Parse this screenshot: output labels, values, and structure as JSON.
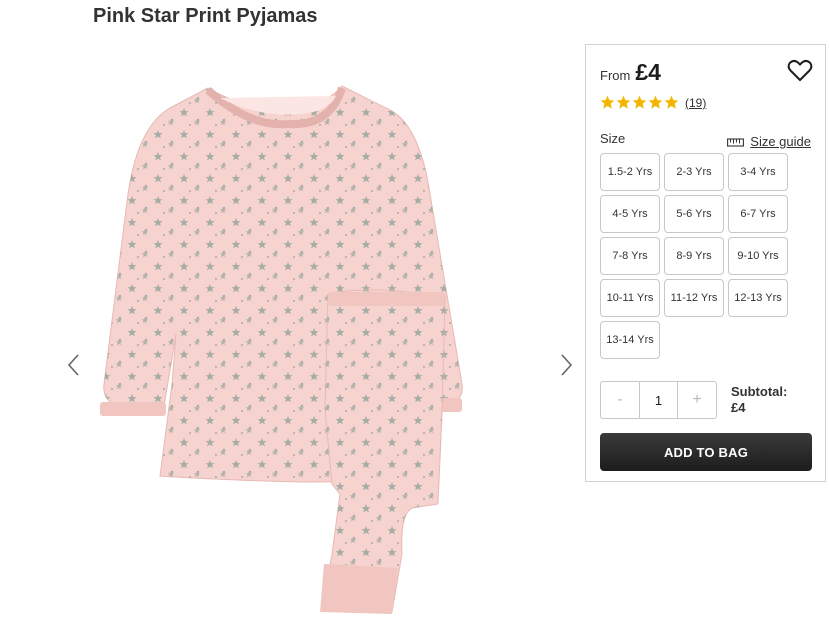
{
  "product": {
    "title": "Pink Star Print Pyjamas",
    "image_alt": "pink-star-print-pyjamas"
  },
  "gallery": {
    "prev_icon": "chevron-left-icon",
    "next_icon": "chevron-right-icon"
  },
  "price": {
    "from_label": "From",
    "value": "£4"
  },
  "wishlist": {
    "icon": "heart-outline-icon"
  },
  "rating": {
    "stars": 5,
    "review_count": "(19)",
    "star_color": "#f2b600"
  },
  "size": {
    "label": "Size",
    "guide_label": "Size guide",
    "guide_icon": "ruler-icon",
    "options": [
      "1.5-2 Yrs",
      "2-3 Yrs",
      "3-4 Yrs",
      "4-5 Yrs",
      "5-6 Yrs",
      "6-7 Yrs",
      "7-8 Yrs",
      "8-9 Yrs",
      "9-10 Yrs",
      "10-11 Yrs",
      "11-12 Yrs",
      "12-13 Yrs",
      "13-14 Yrs"
    ]
  },
  "quantity": {
    "minus": "-",
    "value": "1",
    "plus": "+"
  },
  "subtotal": {
    "label": "Subtotal:",
    "value": "£4"
  },
  "cta": {
    "add_to_bag": "ADD TO BAG"
  },
  "colors": {
    "pyjama_pink": "#f6d3cf",
    "star_grey": "#a7aca6",
    "button_dark": "#262626"
  }
}
